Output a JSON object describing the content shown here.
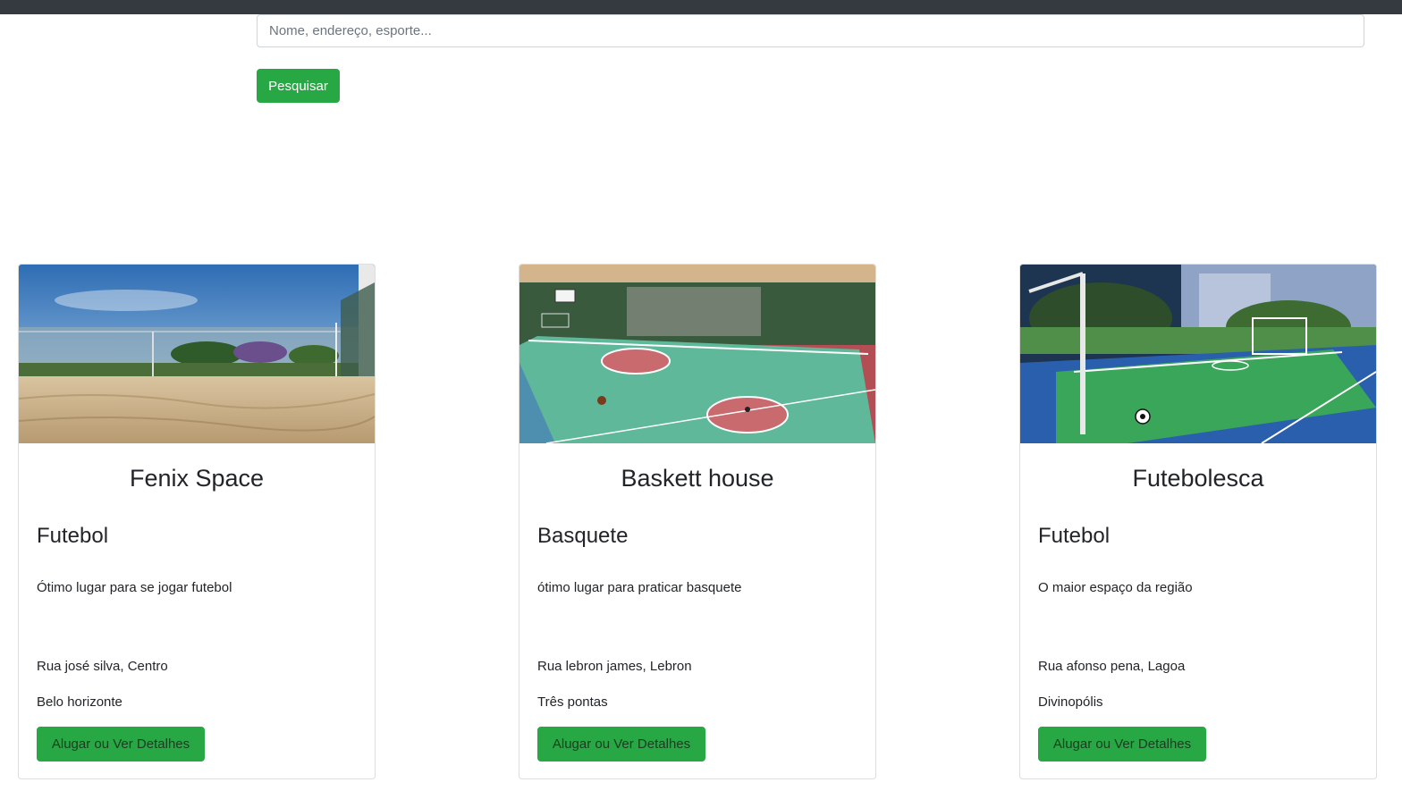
{
  "search": {
    "placeholder": "Nome, endereço, esporte...",
    "button_label": "Pesquisar"
  },
  "cards": [
    {
      "title": "Fenix Space",
      "sport": "Futebol",
      "description": "Ótimo lugar para se jogar futebol",
      "address": "Rua josé silva, Centro",
      "city": "Belo horizonte",
      "button_label": "Alugar ou Ver Detalhes",
      "image": "beach-sand-court-photo"
    },
    {
      "title": "Baskett house",
      "sport": "Basquete",
      "description": "ótimo lugar para praticar basquete",
      "address": "Rua lebron james, Lebron",
      "city": "Três pontas",
      "button_label": "Alugar ou Ver Detalhes",
      "image": "basketball-court-photo"
    },
    {
      "title": "Futebolesca",
      "sport": "Futebol",
      "description": "O maior espaço da região",
      "address": "Rua afonso pena, Lagoa",
      "city": "Divinopólis",
      "button_label": "Alugar ou Ver Detalhes",
      "image": "futsal-court-photo"
    }
  ],
  "colors": {
    "topbar": "#343a40",
    "primary_button": "#28a745"
  }
}
